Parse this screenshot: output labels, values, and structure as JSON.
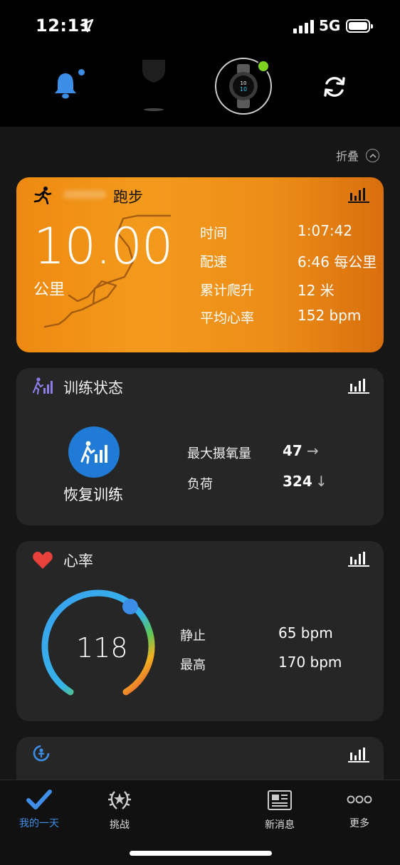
{
  "status_bar": {
    "time": "12:11",
    "network": "5G"
  },
  "header": {
    "icons": [
      "bell-icon",
      "shield-icon",
      "watch-device-icon",
      "sync-icon"
    ],
    "accent": "#3b8de6",
    "device_dot_color": "#7ed321"
  },
  "collapse_label": "折叠",
  "run_card": {
    "title": "跑步",
    "distance": "10.00",
    "distance_unit": "公里",
    "stats": [
      {
        "label": "时间",
        "value": "1:07:42"
      },
      {
        "label": "配速",
        "value": "6:46 每公里"
      },
      {
        "label": "累计爬升",
        "value": "12 米"
      },
      {
        "label": "平均心率",
        "value": "152 bpm"
      }
    ],
    "color": "#f39a1c"
  },
  "training_card": {
    "title": "训练状态",
    "status": "恢复训练",
    "metrics": [
      {
        "label": "最大摄氧量",
        "value": "47",
        "trend": "→"
      },
      {
        "label": "负荷",
        "value": "324",
        "trend": "↓"
      }
    ],
    "icon_color": "#1f7bd6"
  },
  "heart_card": {
    "title": "心率",
    "current": "118",
    "metrics": [
      {
        "label": "静止",
        "value": "65 bpm"
      },
      {
        "label": "最高",
        "value": "170 bpm"
      }
    ],
    "heart_color": "#e8413c"
  },
  "tabbar": {
    "tabs": [
      {
        "label": "我的一天",
        "icon": "check-icon",
        "active": true
      },
      {
        "label": "挑战",
        "icon": "laurel-icon",
        "active": false
      },
      {
        "label": "",
        "icon": "",
        "active": false
      },
      {
        "label": "新消息",
        "icon": "news-icon",
        "active": false
      },
      {
        "label": "更多",
        "icon": "more-icon",
        "active": false
      }
    ]
  }
}
